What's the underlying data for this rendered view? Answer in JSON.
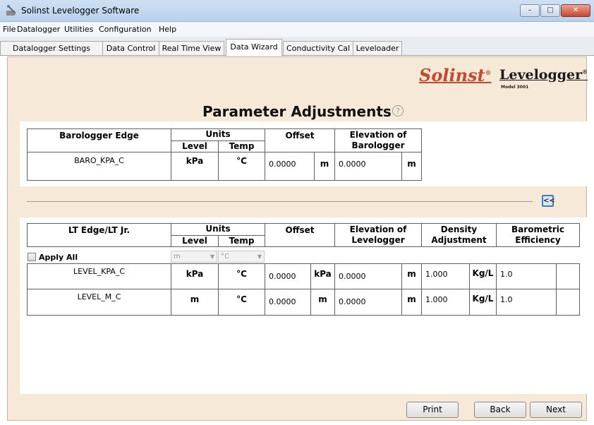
{
  "window": {
    "title": "Solinst Levelogger Software",
    "min": "–",
    "max": "□",
    "close": "✕"
  },
  "menu": [
    "File",
    "Datalogger",
    "Utilities",
    "Configuration",
    "Help"
  ],
  "tabs": [
    "Datalogger Settings",
    "Data Control",
    "Real Time View",
    "Data Wizard",
    "Conductivity Cal",
    "Leveloader"
  ],
  "active_tab": "Data Wizard",
  "brand": {
    "solinst": "Solinst",
    "solinst_mark": "®",
    "levelogger": "Levelogger",
    "levelogger_mark": "®",
    "model": "Model 3001"
  },
  "page": {
    "title": "Parameter Adjustments",
    "help_icon": "?"
  },
  "baro": {
    "header_name": "Barologger Edge",
    "header_units": "Units",
    "header_level": "Level",
    "header_temp": "Temp",
    "header_offset": "Offset",
    "header_elev": "Elevation of Barologger",
    "row": {
      "name": "BARO_KPA_C",
      "level_unit": "kPa",
      "temp_unit": "°C",
      "offset": "0.0000",
      "offset_unit": "m",
      "elevation": "0.0000",
      "elevation_unit": "m"
    }
  },
  "collapse_button": "<<",
  "lt": {
    "header_name": "LT Edge/LT Jr.",
    "header_units": "Units",
    "header_level": "Level",
    "header_temp": "Temp",
    "header_offset": "Offset",
    "header_elev": "Elevation of Levelogger",
    "header_density": "Density Adjustment",
    "header_baro_eff": "Barometric Efficiency",
    "apply_all_label": "Apply All",
    "apply_all_checked": false,
    "apply_level_select": "m",
    "apply_temp_select": "°C",
    "rows": [
      {
        "name": "LEVEL_KPA_C",
        "level_unit": "kPa",
        "temp_unit": "°C",
        "offset": "0.0000",
        "offset_unit": "kPa",
        "elevation": "0.0000",
        "elevation_unit": "m",
        "density": "1.000",
        "density_unit": "Kg/L",
        "baro_eff": "1.0"
      },
      {
        "name": "LEVEL_M_C",
        "level_unit": "m",
        "temp_unit": "°C",
        "offset": "0.0000",
        "offset_unit": "m",
        "elevation": "0.0000",
        "elevation_unit": "m",
        "density": "1.000",
        "density_unit": "Kg/L",
        "baro_eff": "1.0"
      }
    ]
  },
  "buttons": {
    "print": "Print",
    "back": "Back",
    "next": "Next"
  },
  "colors": {
    "panel_bg": "#f7e9d7",
    "solinst_red": "#c8472f",
    "accent_blue": "#3e7dc9"
  }
}
